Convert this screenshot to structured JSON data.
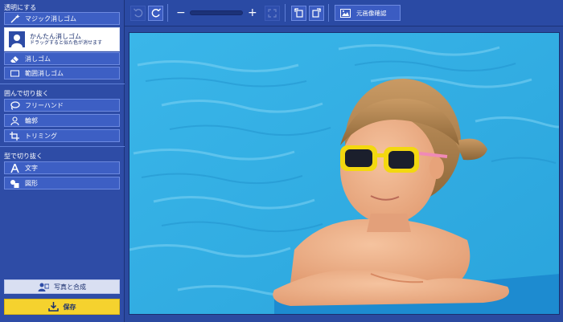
{
  "sidebar": {
    "sections": [
      {
        "title": "透明にする"
      },
      {
        "title": "囲んで切り抜く"
      },
      {
        "title": "型で切り抜く"
      }
    ],
    "transparent_tools": {
      "magic_eraser": "マジック消しゴム",
      "easy_eraser": "かんたん消しゴム",
      "easy_eraser_hint": "ドラッグすると似た色が消せます",
      "eraser": "消しゴム",
      "range_eraser": "範囲消しゴム"
    },
    "enclose_tools": {
      "freehand": "フリーハンド",
      "outline": "輪郭",
      "trimming": "トリミング"
    },
    "shape_tools": {
      "text": "文字",
      "shape": "図形"
    },
    "compose_label": "写真と合成",
    "save_label": "保存"
  },
  "toolbar": {
    "zoom_minus": "−",
    "zoom_plus": "+",
    "zoom_level": 0.05,
    "preview_label": "元画像確認"
  },
  "colors": {
    "accent": "#2e4ca6",
    "save": "#f5d22e",
    "water": "#35b6e8"
  }
}
